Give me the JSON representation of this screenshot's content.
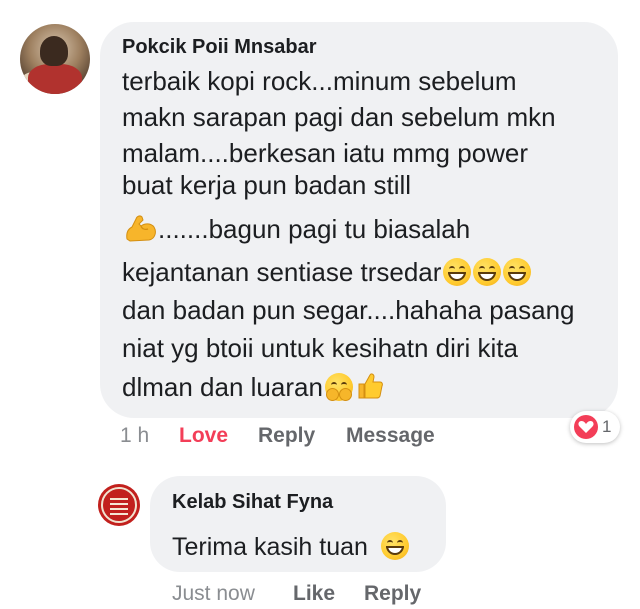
{
  "comment": {
    "author": "Pokcik Poii Mnsabar",
    "lines": [
      "terbaik kopi rock...minum sebelum",
      "makn sarapan pagi dan sebelum mkn",
      "malam....berkesan iatu mmg power",
      "buat kerja pun badan still",
      ".......bagun pagi tu biasalah",
      "kejantanan sentiase trsedar",
      "dan badan pun segar....hahaha pasang",
      "niat yg btoii untuk kesihatn diri kita",
      "dlman dan luaran"
    ],
    "emojis": {
      "line5_start": "flexed-biceps-icon",
      "line6_end": [
        "grinning-face-icon",
        "grinning-face-icon",
        "grinning-face-icon"
      ],
      "line9_end": [
        "hugging-face-icon",
        "thumbs-up-icon"
      ]
    },
    "time": "1 h",
    "love_label": "Love",
    "reply_label": "Reply",
    "message_label": "Message",
    "reaction": {
      "icon": "heart-icon",
      "count": "1",
      "color": "#f33e58"
    }
  },
  "reply": {
    "author": "Kelab Sihat Fyna",
    "text": "Terima kasih tuan",
    "emoji": "grinning-face-icon",
    "time": "Just now",
    "like_label": "Like",
    "reply_label": "Reply"
  },
  "colors": {
    "bubble": "#f0f1f3",
    "love": "#f33e58",
    "action_text": "#65676b"
  }
}
